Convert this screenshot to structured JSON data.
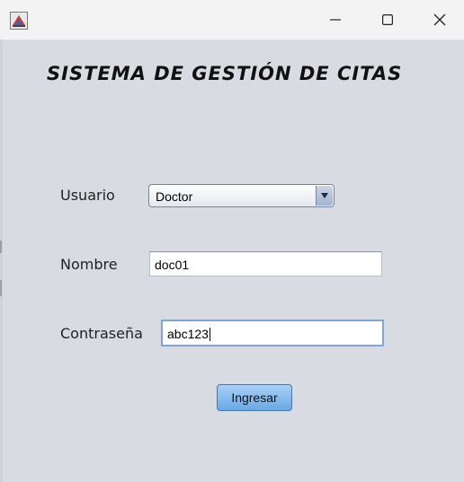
{
  "window": {
    "icons": {
      "app": "java-app-icon",
      "minimize": "minimize-icon",
      "maximize": "maximize-icon",
      "close": "close-icon"
    }
  },
  "form": {
    "title": "SISTEMA DE GESTIÓN DE CITAS",
    "user_label": "Usuario",
    "user_selected": "Doctor",
    "name_label": "Nombre",
    "name_value": "doc01",
    "password_label": "Contraseña",
    "password_value": "abc123",
    "submit_label": "Ingresar"
  },
  "colors": {
    "background": "#d8dbe2",
    "button": "#6aa8e6",
    "focus_border": "#7fa6d6"
  }
}
